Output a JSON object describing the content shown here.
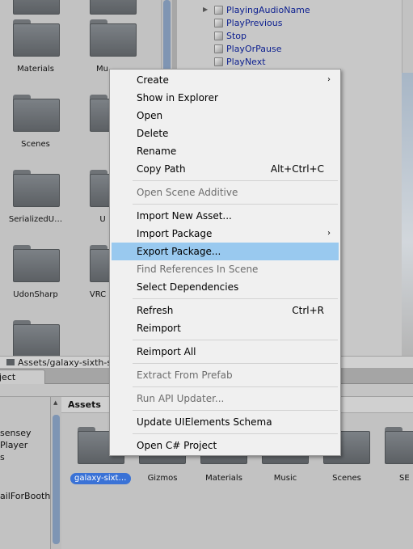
{
  "upper_grid": {
    "folders": [
      {
        "label": "Materials"
      },
      {
        "label": "Mu"
      },
      {
        "label": "Scenes"
      },
      {
        "label": ""
      },
      {
        "label": "SerializedU…"
      },
      {
        "label": "U"
      },
      {
        "label": "UdonSharp"
      },
      {
        "label": "VRC"
      },
      {
        "label": ""
      }
    ]
  },
  "hierarchy": {
    "items": [
      {
        "label": "PlayingAudioName"
      },
      {
        "label": "PlayPrevious"
      },
      {
        "label": "Stop"
      },
      {
        "label": "PlayOrPause"
      },
      {
        "label": "PlayNext"
      }
    ]
  },
  "pathbar": {
    "path": "Assets/galaxy-sixth-sc"
  },
  "tabs": {
    "project": "ject"
  },
  "tree": {
    "items": [
      {
        "label": "sensey"
      },
      {
        "label": "Player"
      },
      {
        "label": "s"
      },
      {
        "label": "ailForBooth"
      }
    ]
  },
  "assets": {
    "header": "Assets",
    "folders": [
      {
        "label": "galaxy-sixt…",
        "selected": true
      },
      {
        "label": "Gizmos"
      },
      {
        "label": "Materials"
      },
      {
        "label": "Music"
      },
      {
        "label": "Scenes"
      },
      {
        "label": "SE"
      }
    ]
  },
  "context_menu": {
    "items": [
      {
        "label": "Create",
        "submenu": true
      },
      {
        "label": "Show in Explorer"
      },
      {
        "label": "Open"
      },
      {
        "label": "Delete"
      },
      {
        "label": "Rename"
      },
      {
        "label": "Copy Path",
        "shortcut": "Alt+Ctrl+C"
      },
      {
        "label": "Open Scene Additive",
        "disabled": true
      },
      {
        "label": "Import New Asset..."
      },
      {
        "label": "Import Package",
        "submenu": true
      },
      {
        "label": "Export Package...",
        "highlighted": true
      },
      {
        "label": "Find References In Scene",
        "disabled": true
      },
      {
        "label": "Select Dependencies"
      },
      {
        "label": "Refresh",
        "shortcut": "Ctrl+R"
      },
      {
        "label": "Reimport"
      },
      {
        "label": "Reimport All"
      },
      {
        "label": "Extract From Prefab",
        "disabled": true
      },
      {
        "label": "Run API Updater...",
        "disabled": true
      },
      {
        "label": "Update UIElements Schema"
      },
      {
        "label": "Open C# Project"
      }
    ],
    "submenu_glyph": "›"
  },
  "colors": {
    "menu_highlight": "#99c9ef",
    "selection": "#3a72d6",
    "hierarchy_text": "#0c1f8f"
  }
}
